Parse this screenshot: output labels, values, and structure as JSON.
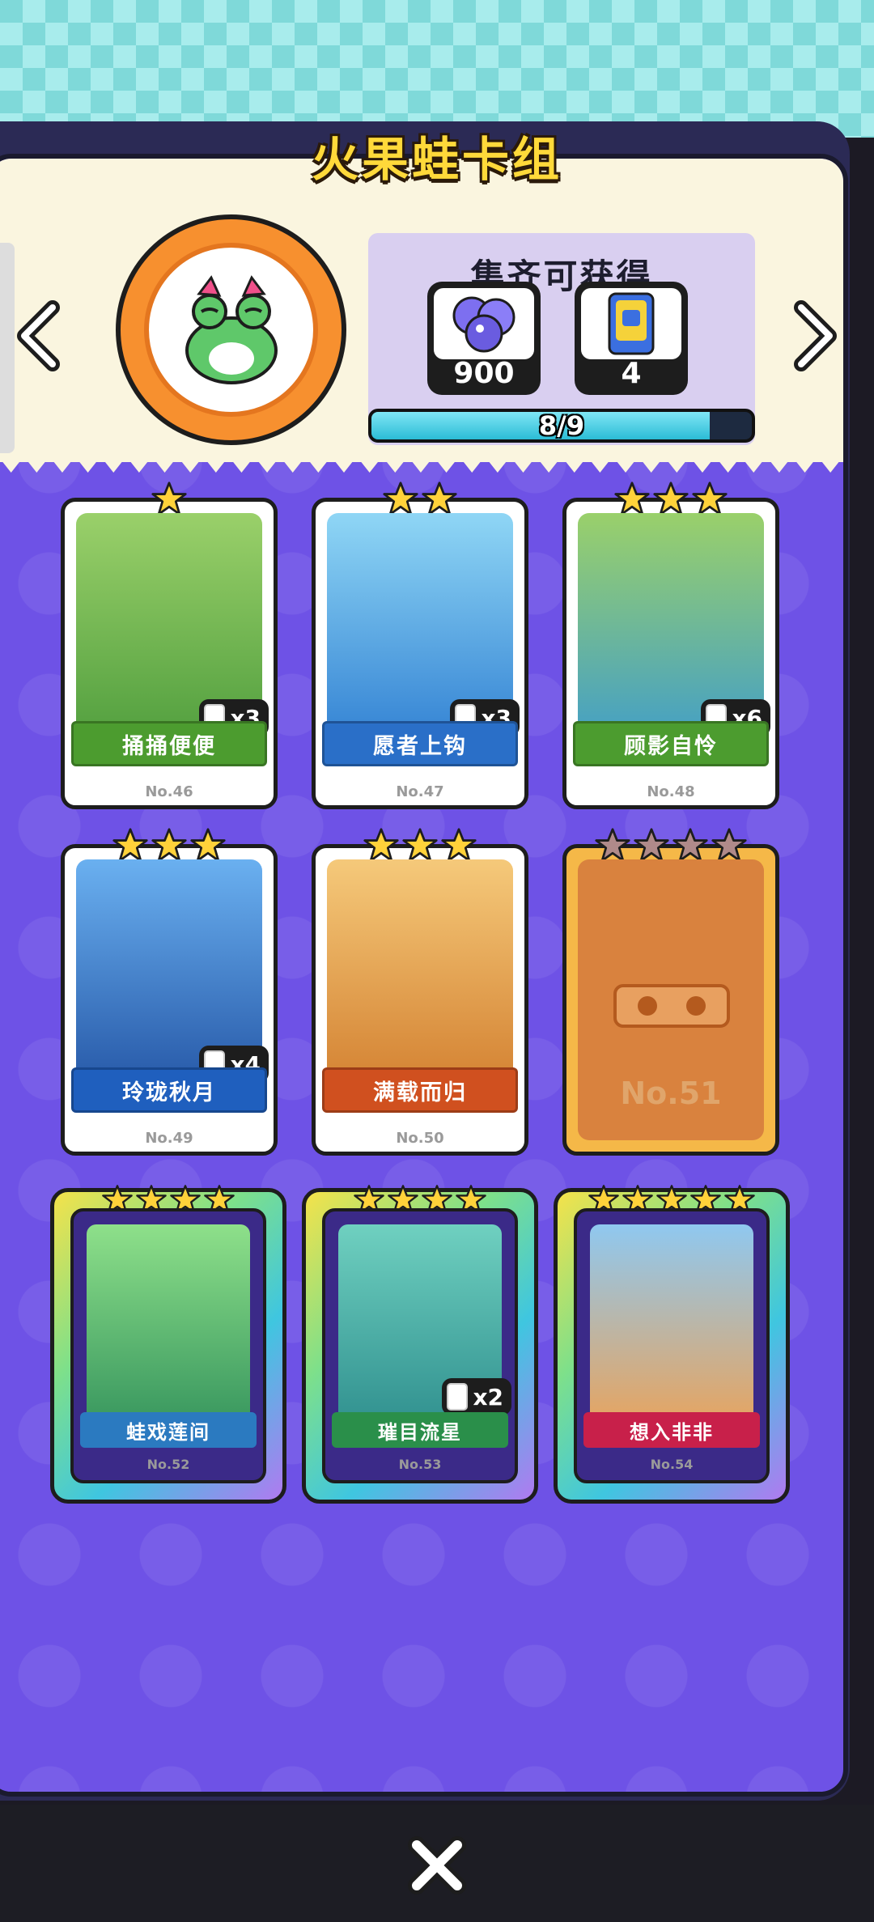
{
  "header": {
    "title": "火果蛙卡组"
  },
  "reward": {
    "title": "集齐可获得",
    "items": [
      {
        "icon": "orb-bundle-icon",
        "amount": "900"
      },
      {
        "icon": "card-pack-icon",
        "amount": "4"
      }
    ],
    "progress_text": "8/9",
    "progress_fraction": 0.89
  },
  "colors": {
    "accent": "#6e52e6",
    "banner_green": "#3e9a3a",
    "banner_blue": "#1f6cc0",
    "banner_orange": "#d9531f",
    "banner_red": "#d02a50"
  },
  "cards": [
    {
      "name": "捅捅便便",
      "no": "No.46",
      "stars": 1,
      "count": "x3",
      "banner": "#4c9c2f",
      "bg": "#7ac24a"
    },
    {
      "name": "愿者上钩",
      "no": "No.47",
      "stars": 2,
      "count": "x3",
      "banner": "#2a6fc8",
      "bg": "#5ab8f0"
    },
    {
      "name": "顾影自怜",
      "no": "No.48",
      "stars": 3,
      "count": "x6",
      "banner": "#4c9c2f",
      "bg": "#7ac24a"
    },
    {
      "name": "玲珑秋月",
      "no": "No.49",
      "stars": 3,
      "count": "x4",
      "banner": "#1f5fbe",
      "bg": "#3b8ee0"
    },
    {
      "name": "满载而归",
      "no": "No.50",
      "stars": 3,
      "count": "",
      "banner": "#d0501f",
      "bg": "#f2a04a"
    },
    {
      "name": "",
      "no": "No.51",
      "stars": 4,
      "count": "",
      "banner": "",
      "bg": "#d9823e"
    },
    {
      "name": "蛙戏莲间",
      "no": "No.52",
      "stars": 4,
      "count": "",
      "banner": "#2b7ac0",
      "bg": "#6cd07a"
    },
    {
      "name": "璀目流星",
      "no": "No.53",
      "stars": 4,
      "count": "x2",
      "banner": "#2a8f4a",
      "bg": "#4fc0c0"
    },
    {
      "name": "想入非非",
      "no": "No.54",
      "stars": 5,
      "count": "",
      "banner": "#c8204a",
      "bg": "#f0b040"
    }
  ]
}
